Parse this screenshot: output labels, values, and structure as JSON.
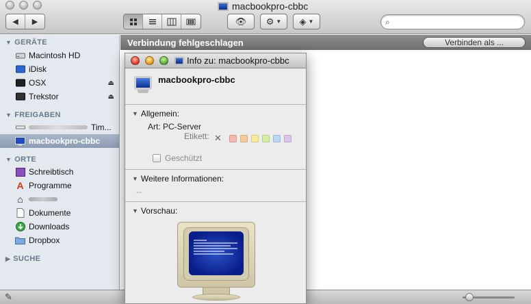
{
  "window": {
    "title": "macbookpro-cbbc"
  },
  "toolbar": {
    "back_icon": "back-arrow-icon",
    "forward_icon": "forward-arrow-icon",
    "views": [
      "icon-view",
      "list-view",
      "column-view",
      "coverflow-view"
    ],
    "quicklook_icon": "eye-icon",
    "action_icon": "gear-icon",
    "dropbox_icon": "dropbox-icon",
    "search": {
      "value": "",
      "placeholder": ""
    }
  },
  "sidebar": {
    "sections": [
      {
        "title": "GERÄTE",
        "items": [
          {
            "label": "Macintosh HD",
            "icon": "hard-drive-icon"
          },
          {
            "label": "iDisk",
            "icon": "idisk-icon"
          },
          {
            "label": "OSX",
            "icon": "disk-icon",
            "eject": true
          },
          {
            "label": "Trekstor",
            "icon": "disk-icon",
            "eject": true
          }
        ]
      },
      {
        "title": "FREIGABEN",
        "items": [
          {
            "label": "Tim...",
            "icon": "shared-computer-icon"
          },
          {
            "label": "macbookpro-cbbc",
            "icon": "monitor-icon",
            "selected": true
          }
        ]
      },
      {
        "title": "ORTE",
        "items": [
          {
            "label": "Schreibtisch",
            "icon": "desktop-icon"
          },
          {
            "label": "Programme",
            "icon": "applications-icon"
          },
          {
            "label": "",
            "icon": "home-icon"
          },
          {
            "label": "Dokumente",
            "icon": "documents-icon"
          },
          {
            "label": "Downloads",
            "icon": "downloads-icon"
          },
          {
            "label": "Dropbox",
            "icon": "dropbox-folder-icon"
          }
        ]
      },
      {
        "title": "SUCHE",
        "items": []
      }
    ]
  },
  "main": {
    "banner": "Verbindung fehlgeschlagen",
    "connect_button": "Verbinden als ..."
  },
  "info_panel": {
    "title": "Info zu: macbookpro-cbbc",
    "name": "macbookpro-cbbc",
    "general": {
      "label": "Allgemein:",
      "kind_label": "Art:",
      "kind_value": "PC-Server",
      "tag_label": "Etikett:",
      "tag_colors": [
        "#f6b8aa",
        "#f8cc97",
        "#f6ec9a",
        "#d6eea1",
        "#b9d8f4",
        "#dcc3ec"
      ],
      "protected_label": "Geschützt"
    },
    "more_info": {
      "label": "Weitere Informationen:",
      "value": "--"
    },
    "preview": {
      "label": "Vorschau:"
    }
  }
}
